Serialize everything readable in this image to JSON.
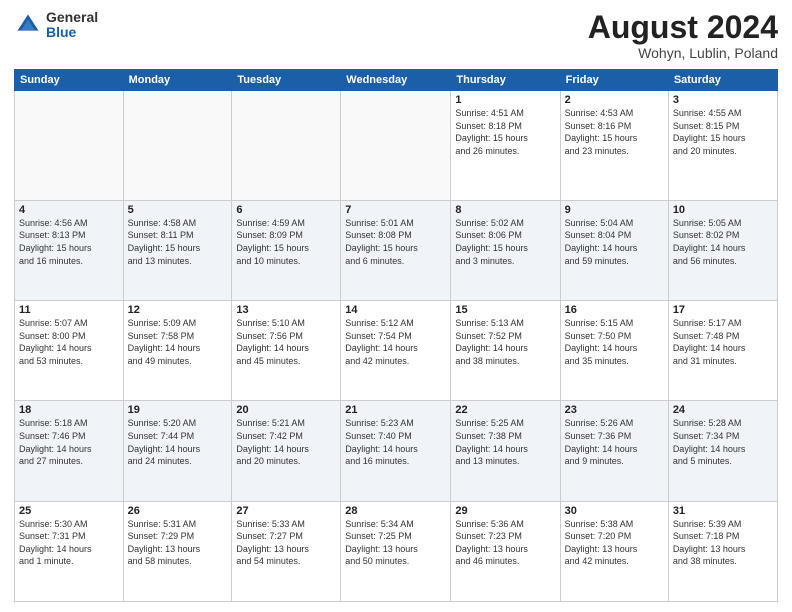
{
  "logo": {
    "general": "General",
    "blue": "Blue"
  },
  "header": {
    "month": "August 2024",
    "location": "Wohyn, Lublin, Poland"
  },
  "weekdays": [
    "Sunday",
    "Monday",
    "Tuesday",
    "Wednesday",
    "Thursday",
    "Friday",
    "Saturday"
  ],
  "weeks": [
    [
      {
        "day": "",
        "info": ""
      },
      {
        "day": "",
        "info": ""
      },
      {
        "day": "",
        "info": ""
      },
      {
        "day": "",
        "info": ""
      },
      {
        "day": "1",
        "info": "Sunrise: 4:51 AM\nSunset: 8:18 PM\nDaylight: 15 hours\nand 26 minutes."
      },
      {
        "day": "2",
        "info": "Sunrise: 4:53 AM\nSunset: 8:16 PM\nDaylight: 15 hours\nand 23 minutes."
      },
      {
        "day": "3",
        "info": "Sunrise: 4:55 AM\nSunset: 8:15 PM\nDaylight: 15 hours\nand 20 minutes."
      }
    ],
    [
      {
        "day": "4",
        "info": "Sunrise: 4:56 AM\nSunset: 8:13 PM\nDaylight: 15 hours\nand 16 minutes."
      },
      {
        "day": "5",
        "info": "Sunrise: 4:58 AM\nSunset: 8:11 PM\nDaylight: 15 hours\nand 13 minutes."
      },
      {
        "day": "6",
        "info": "Sunrise: 4:59 AM\nSunset: 8:09 PM\nDaylight: 15 hours\nand 10 minutes."
      },
      {
        "day": "7",
        "info": "Sunrise: 5:01 AM\nSunset: 8:08 PM\nDaylight: 15 hours\nand 6 minutes."
      },
      {
        "day": "8",
        "info": "Sunrise: 5:02 AM\nSunset: 8:06 PM\nDaylight: 15 hours\nand 3 minutes."
      },
      {
        "day": "9",
        "info": "Sunrise: 5:04 AM\nSunset: 8:04 PM\nDaylight: 14 hours\nand 59 minutes."
      },
      {
        "day": "10",
        "info": "Sunrise: 5:05 AM\nSunset: 8:02 PM\nDaylight: 14 hours\nand 56 minutes."
      }
    ],
    [
      {
        "day": "11",
        "info": "Sunrise: 5:07 AM\nSunset: 8:00 PM\nDaylight: 14 hours\nand 53 minutes."
      },
      {
        "day": "12",
        "info": "Sunrise: 5:09 AM\nSunset: 7:58 PM\nDaylight: 14 hours\nand 49 minutes."
      },
      {
        "day": "13",
        "info": "Sunrise: 5:10 AM\nSunset: 7:56 PM\nDaylight: 14 hours\nand 45 minutes."
      },
      {
        "day": "14",
        "info": "Sunrise: 5:12 AM\nSunset: 7:54 PM\nDaylight: 14 hours\nand 42 minutes."
      },
      {
        "day": "15",
        "info": "Sunrise: 5:13 AM\nSunset: 7:52 PM\nDaylight: 14 hours\nand 38 minutes."
      },
      {
        "day": "16",
        "info": "Sunrise: 5:15 AM\nSunset: 7:50 PM\nDaylight: 14 hours\nand 35 minutes."
      },
      {
        "day": "17",
        "info": "Sunrise: 5:17 AM\nSunset: 7:48 PM\nDaylight: 14 hours\nand 31 minutes."
      }
    ],
    [
      {
        "day": "18",
        "info": "Sunrise: 5:18 AM\nSunset: 7:46 PM\nDaylight: 14 hours\nand 27 minutes."
      },
      {
        "day": "19",
        "info": "Sunrise: 5:20 AM\nSunset: 7:44 PM\nDaylight: 14 hours\nand 24 minutes."
      },
      {
        "day": "20",
        "info": "Sunrise: 5:21 AM\nSunset: 7:42 PM\nDaylight: 14 hours\nand 20 minutes."
      },
      {
        "day": "21",
        "info": "Sunrise: 5:23 AM\nSunset: 7:40 PM\nDaylight: 14 hours\nand 16 minutes."
      },
      {
        "day": "22",
        "info": "Sunrise: 5:25 AM\nSunset: 7:38 PM\nDaylight: 14 hours\nand 13 minutes."
      },
      {
        "day": "23",
        "info": "Sunrise: 5:26 AM\nSunset: 7:36 PM\nDaylight: 14 hours\nand 9 minutes."
      },
      {
        "day": "24",
        "info": "Sunrise: 5:28 AM\nSunset: 7:34 PM\nDaylight: 14 hours\nand 5 minutes."
      }
    ],
    [
      {
        "day": "25",
        "info": "Sunrise: 5:30 AM\nSunset: 7:31 PM\nDaylight: 14 hours\nand 1 minute."
      },
      {
        "day": "26",
        "info": "Sunrise: 5:31 AM\nSunset: 7:29 PM\nDaylight: 13 hours\nand 58 minutes."
      },
      {
        "day": "27",
        "info": "Sunrise: 5:33 AM\nSunset: 7:27 PM\nDaylight: 13 hours\nand 54 minutes."
      },
      {
        "day": "28",
        "info": "Sunrise: 5:34 AM\nSunset: 7:25 PM\nDaylight: 13 hours\nand 50 minutes."
      },
      {
        "day": "29",
        "info": "Sunrise: 5:36 AM\nSunset: 7:23 PM\nDaylight: 13 hours\nand 46 minutes."
      },
      {
        "day": "30",
        "info": "Sunrise: 5:38 AM\nSunset: 7:20 PM\nDaylight: 13 hours\nand 42 minutes."
      },
      {
        "day": "31",
        "info": "Sunrise: 5:39 AM\nSunset: 7:18 PM\nDaylight: 13 hours\nand 38 minutes."
      }
    ]
  ]
}
